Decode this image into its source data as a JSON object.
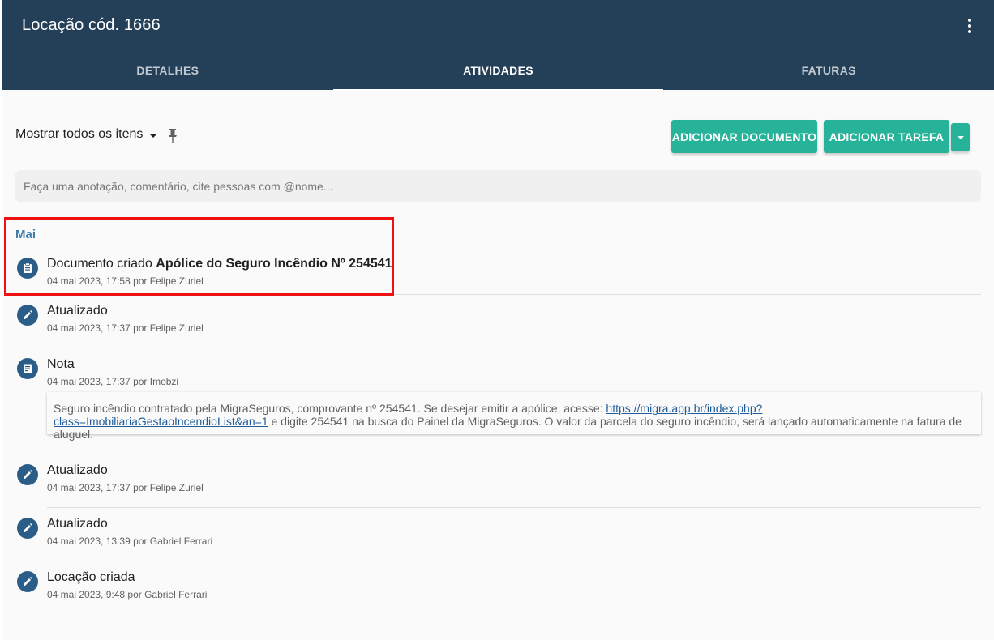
{
  "header": {
    "title": "Locação cód. 1666",
    "more_icon": "more-vertical-icon"
  },
  "tabs": [
    {
      "label": "DETALHES",
      "active": false
    },
    {
      "label": "ATIVIDADES",
      "active": true
    },
    {
      "label": "FATURAS",
      "active": false
    }
  ],
  "toolbar": {
    "filter_label": "Mostrar todos os itens",
    "add_document_label": "ADICIONAR DOCUMENTO",
    "add_task_label": "ADICIONAR TAREFA"
  },
  "note_input": {
    "placeholder": "Faça uma anotação, comentário, cite pessoas com @nome..."
  },
  "timeline": {
    "month": "Mai",
    "items": [
      {
        "icon": "clipboard-icon",
        "title_prefix": "Documento criado ",
        "title_bold": "Apólice do Seguro Incêndio Nº 254541",
        "meta": "04 mai 2023, 17:58 por Felipe Zuriel"
      },
      {
        "icon": "pencil-icon",
        "title": "Atualizado",
        "meta": "04 mai 2023, 17:37 por Felipe Zuriel"
      },
      {
        "icon": "note-icon",
        "title": "Nota",
        "meta": "04 mai 2023, 17:37 por Imobzi",
        "note_text_before": "Seguro incêndio contratado pela MigraSeguros, comprovante nº 254541. Se desejar emitir a apólice, acesse: ",
        "note_link": "https://migra.app.br/index.php?class=ImobiliariaGestaoIncendioList&an=1",
        "note_text_after": " e digite 254541 na busca do Painel da MigraSeguros. O valor da parcela do seguro incêndio, será lançado automaticamente na fatura de aluguel."
      },
      {
        "icon": "pencil-icon",
        "title": "Atualizado",
        "meta": "04 mai 2023, 17:37 por Felipe Zuriel"
      },
      {
        "icon": "pencil-icon",
        "title": "Atualizado",
        "meta": "04 mai 2023, 13:39 por Gabriel Ferrari"
      },
      {
        "icon": "pencil-icon",
        "title": "Locação criada",
        "meta": "04 mai 2023, 9:48 por Gabriel Ferrari"
      }
    ]
  },
  "colors": {
    "header_bg": "#243f58",
    "accent": "#26b399",
    "timeline_icon": "#2a5d87",
    "highlight": "#ee1111"
  }
}
